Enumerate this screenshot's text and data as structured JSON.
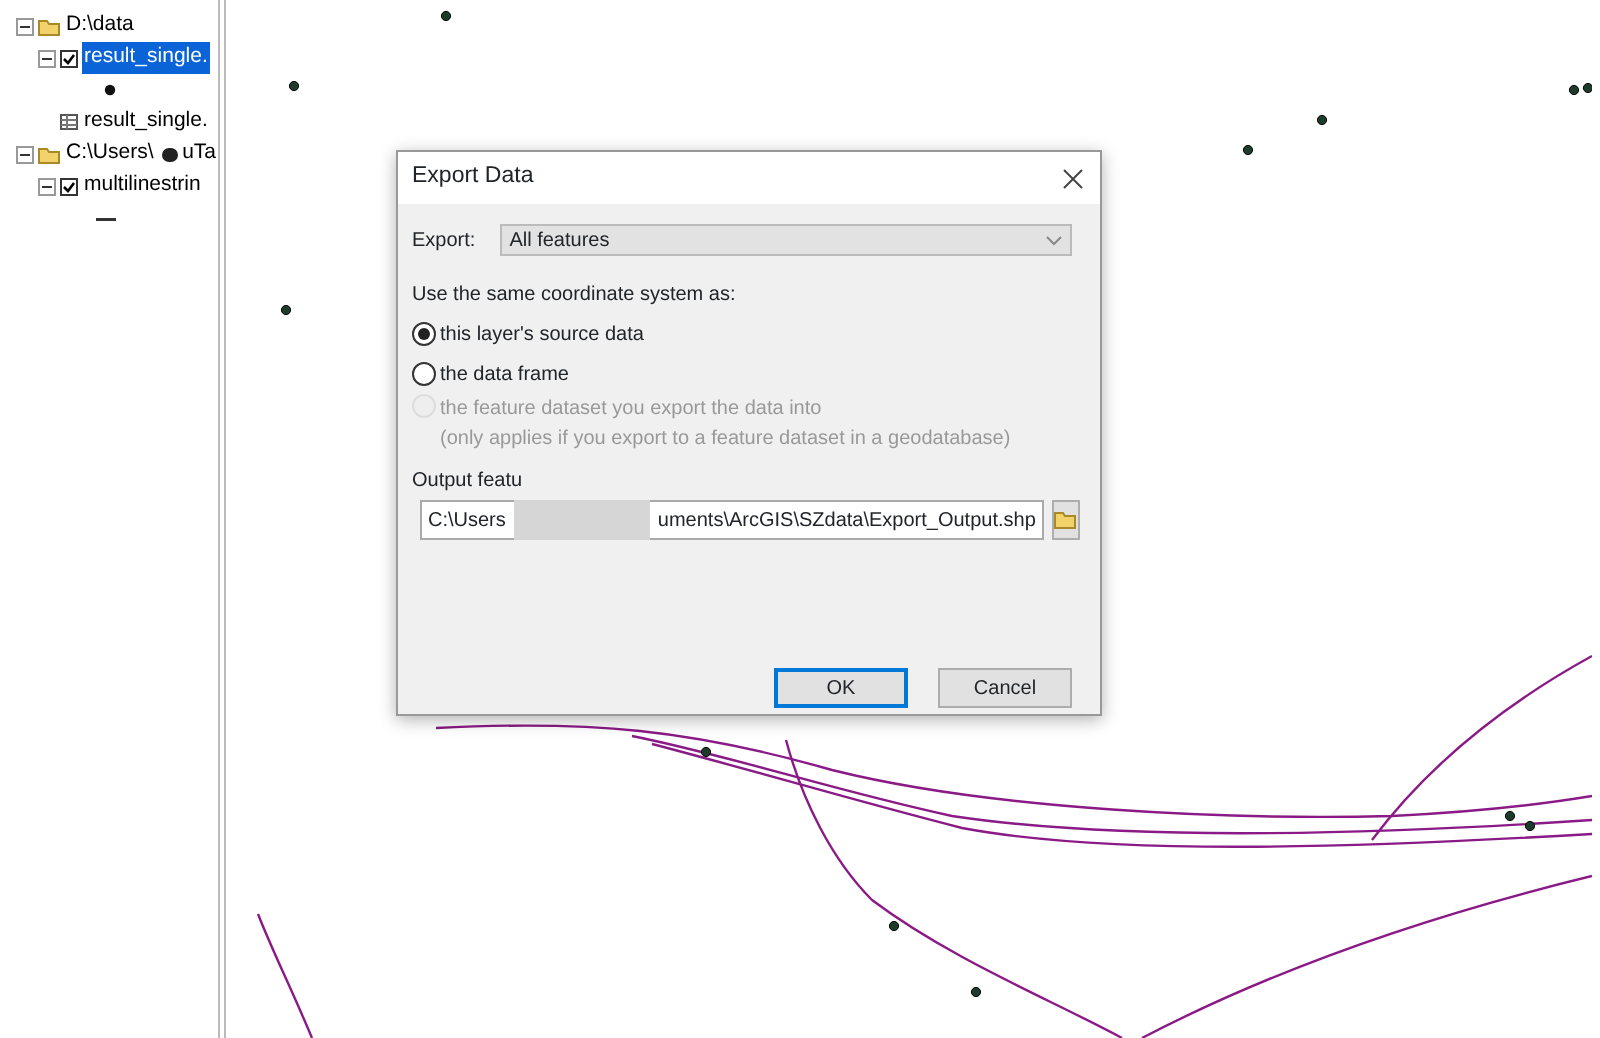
{
  "tree": [
    {
      "label": "D:\\data",
      "kind": "folder",
      "expanded": true,
      "children": [
        {
          "label": "result_single.",
          "kind": "layer",
          "checked": true,
          "selected": true,
          "expanded": true,
          "children": [
            {
              "kind": "point-symbol"
            }
          ]
        },
        {
          "label": "result_single.",
          "kind": "table"
        }
      ]
    },
    {
      "label": "C:\\Users\\",
      "label_tail": "uTa",
      "kind": "folder",
      "expanded": true,
      "children": [
        {
          "label": "multilinestrin",
          "kind": "layer",
          "checked": true,
          "selected": false,
          "expanded": true,
          "children": [
            {
              "kind": "line-symbol"
            }
          ]
        }
      ]
    }
  ],
  "dialog": {
    "title": "Export Data",
    "export_label": "Export:",
    "export_value": "All features",
    "coord_label": "Use the same coordinate system as:",
    "options": [
      {
        "label": "this layer's source data",
        "selected": true,
        "disabled": false
      },
      {
        "label": "the data frame",
        "selected": false,
        "disabled": false
      },
      {
        "label": "the feature dataset you export the data into",
        "note": "(only applies if you export to a feature dataset in a geodatabase)",
        "selected": false,
        "disabled": true
      }
    ],
    "output_label": "Output featu",
    "path_start": "C:\\Users",
    "path_end": "uments\\ArcGIS\\SZdata\\Export_Output.shp",
    "buttons": [
      {
        "label": "OK",
        "default": true
      },
      {
        "label": "Cancel",
        "default": false
      }
    ]
  }
}
